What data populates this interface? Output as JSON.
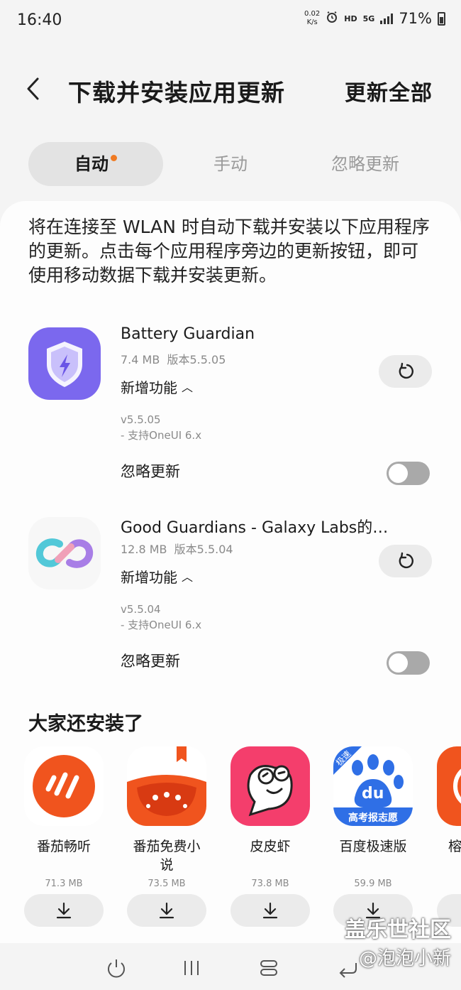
{
  "status": {
    "time": "16:40",
    "net_speed_top": "0.02",
    "net_speed_bottom": "K/s",
    "hd": "HD",
    "net_type": "5G",
    "battery": "71%"
  },
  "header": {
    "title": "下载并安装应用更新",
    "update_all": "更新全部"
  },
  "tabs": [
    {
      "label": "自动",
      "active": true
    },
    {
      "label": "手动",
      "active": false
    },
    {
      "label": "忽略更新",
      "active": false
    }
  ],
  "intro": "将在连接至 WLAN 时自动下载并安装以下应用程序的更新。点击每个应用程序旁边的更新按钮，即可使用移动数据下载并安装更新。",
  "apps": [
    {
      "name": "Battery Guardian",
      "size": "7.4 MB",
      "version": "版本5.5.05",
      "new_features": "新增功能",
      "ver_line": "v5.5.05",
      "note": "- 支持OneUI 6.x",
      "ignore_label": "忽略更新",
      "ignore_on": false
    },
    {
      "name": "Good Guardians - Galaxy Labs的…",
      "size": "12.8 MB",
      "version": "版本5.5.04",
      "new_features": "新增功能",
      "ver_line": "v5.5.04",
      "note": "- 支持OneUI 6.x",
      "ignore_label": "忽略更新",
      "ignore_on": false
    }
  ],
  "recommend": {
    "title": "大家还安装了",
    "items": [
      {
        "name": "番茄畅听",
        "size": "71.3 MB"
      },
      {
        "name": "番茄免费小说",
        "size": "73.5 MB"
      },
      {
        "name": "皮皮虾",
        "size": "73.8 MB"
      },
      {
        "name": "百度极速版",
        "size": "59.9 MB",
        "icon_badge": "极速",
        "icon_text": "du",
        "icon_banner": "高考报志愿"
      },
      {
        "name": "榕",
        "size": ""
      }
    ]
  },
  "watermark": {
    "line1": "盖乐世社区",
    "line2": "@泡泡小新"
  },
  "colors": {
    "accent_dot": "#f07a22",
    "battery_icon": "#7b68ee",
    "tomato": "#f0541e",
    "pipixia": "#f43e6c",
    "baidu": "#2f6fe6"
  }
}
